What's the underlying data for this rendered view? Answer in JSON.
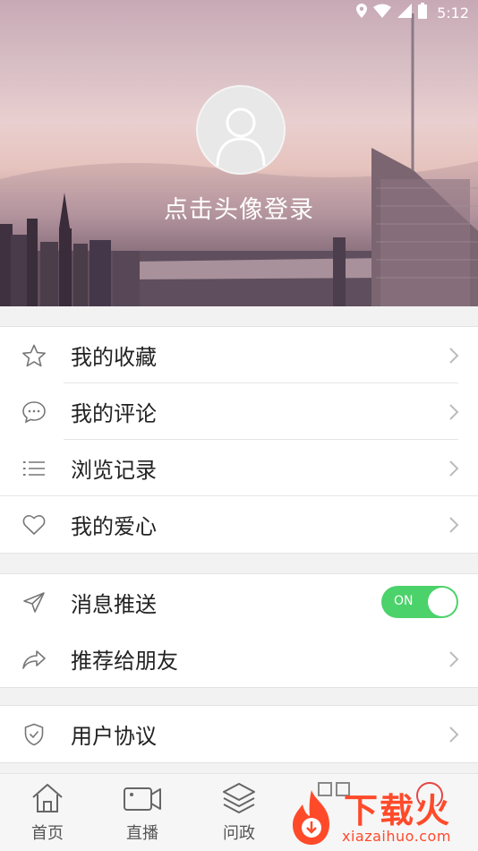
{
  "status_bar": {
    "time": "5:12"
  },
  "header": {
    "login_prompt": "点击头像登录"
  },
  "menu_group_1": [
    {
      "label": "我的收藏",
      "icon": "star-icon"
    },
    {
      "label": "我的评论",
      "icon": "comment-icon"
    },
    {
      "label": "浏览记录",
      "icon": "list-icon"
    },
    {
      "label": "我的爱心",
      "icon": "heart-icon"
    }
  ],
  "menu_group_2": [
    {
      "label": "消息推送",
      "icon": "send-icon",
      "toggle": "ON"
    },
    {
      "label": "推荐给朋友",
      "icon": "share-icon"
    }
  ],
  "menu_group_3": [
    {
      "label": "用户协议",
      "icon": "shield-icon"
    }
  ],
  "tabbar": [
    {
      "label": "首页",
      "icon": "home-icon"
    },
    {
      "label": "直播",
      "icon": "video-icon"
    },
    {
      "label": "问政",
      "icon": "layers-icon"
    }
  ],
  "watermark": {
    "title": "下载火",
    "url": "xiazaihuo.com"
  },
  "colors": {
    "toggle_on": "#4bd26a",
    "watermark": "#ff4a2a"
  }
}
